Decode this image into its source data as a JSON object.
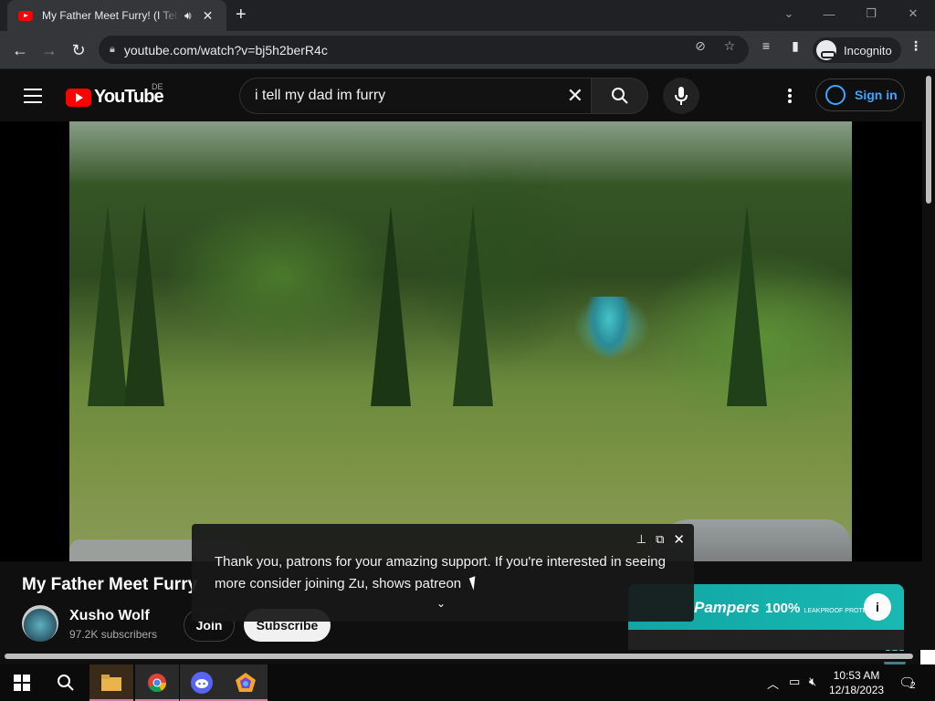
{
  "browser": {
    "tab_title": "My Father Meet Furry! (I Tell",
    "url": "youtube.com/watch?v=bj5h2berR4c",
    "profile_label": "Incognito"
  },
  "youtube": {
    "logo_text": "YouTube",
    "region": "DE",
    "search_query": "i tell my dad im furry",
    "signin_label": "Sign in"
  },
  "video": {
    "title": "My Father Meet Furry",
    "channel_name": "Xusho Wolf",
    "subscribers": "97.2K subscribers",
    "join_label": "Join",
    "subscribe_label": "Subscribe"
  },
  "caption_popup": {
    "text": "Thank you, patrons for your amazing support. If you're interested in seeing more consider joining Zu, shows patreon"
  },
  "ad": {
    "brand": "Pampers",
    "tagline": "100%",
    "tagline_small": "LEAKPROOF PROTECTION"
  },
  "taskbar": {
    "time": "10:53 AM",
    "date": "12/18/2023",
    "notification_count": "2"
  },
  "colors": {
    "youtube_red": "#ff0000",
    "link_blue": "#3ea6ff",
    "ad_teal": "#11a5a5"
  }
}
